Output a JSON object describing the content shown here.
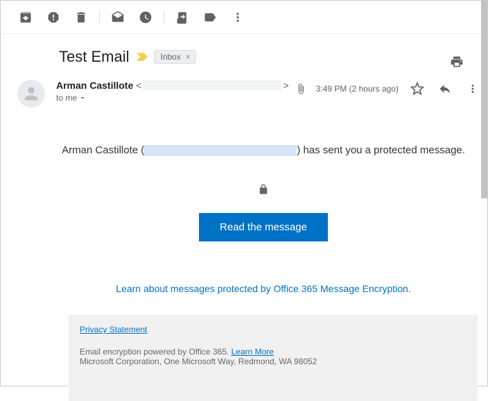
{
  "toolbar": {
    "archive": "Archive",
    "spam": "Report spam",
    "delete": "Delete",
    "unread": "Mark as unread",
    "snooze": "Snooze",
    "moveto": "Move to",
    "labels": "Labels",
    "more": "More"
  },
  "subject": "Test Email",
  "label_chip": "Inbox",
  "sender": {
    "name": "Arman Castillote",
    "to": "to me",
    "time": "3:49 PM (2 hours ago)"
  },
  "body": {
    "sender_repeat": "Arman Castillote",
    "open_paren": " (",
    "close_paren": ") ",
    "text_after": "has sent you a protected message.",
    "cta": "Read the message",
    "learn_link": "Learn about messages protected by Office 365 Message Encryption."
  },
  "footer": {
    "privacy": "Privacy Statement",
    "line1a": "Email encryption powered by Office 365. ",
    "learn_more": "Learn More",
    "line2": "Microsoft Corporation, One Microsoft Way, Redmond, WA 98052"
  }
}
